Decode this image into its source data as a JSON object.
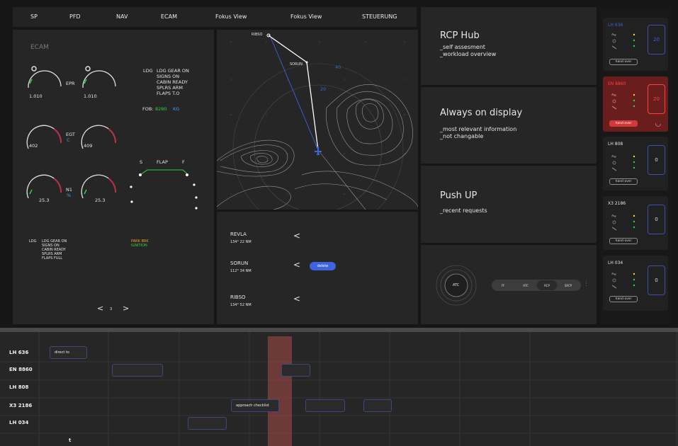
{
  "nav": {
    "items": [
      "SP",
      "PFD",
      "NAV",
      "ECAM",
      "Fokus View",
      "Fokus View",
      "STEUERUNG"
    ]
  },
  "ecam": {
    "title": "ECAM",
    "gauges": [
      {
        "value": "1.010",
        "label": "EPR"
      },
      {
        "value": "1.010",
        "label": ""
      },
      {
        "value": "402",
        "label": "EGT",
        "sub": "C"
      },
      {
        "value": "409",
        "label": ""
      },
      {
        "value": "25.3",
        "label": "N1",
        "sub": "%"
      },
      {
        "value": "25.3",
        "label": ""
      }
    ],
    "ldg_prefix": "LDG",
    "memo_upper": [
      "LDG GEAR ON",
      "SIGNS ON",
      "CABIN READY",
      "SPLRS ARM",
      "FLAPS T.O"
    ],
    "fob_label": "FOB:",
    "fob_value": "8280",
    "fob_unit": "KG",
    "flap_s": "S",
    "flap_label": "FLAP",
    "flap_f": "F",
    "memo_lower_prefix": "LDG",
    "memo_lower": [
      "LDG GEAR ON",
      "SIGNS ON",
      "CABIN READY",
      "SPLRS ARM",
      "FLAPS FULL"
    ],
    "memo_amber": "PARK BRK",
    "memo_green": "IGNITION",
    "page_prev": "<",
    "page_num": "3",
    "page_next": ">"
  },
  "nav_map": {
    "wpt_ribso": "RIBSO",
    "wpt_sorun": "SORUN",
    "range_40": "40",
    "range_20": "20"
  },
  "waypoints": [
    {
      "name": "REVLA",
      "detail": "134°   22 NM"
    },
    {
      "name": "SORUN",
      "detail": "112°   34 NM"
    },
    {
      "name": "RIBSO",
      "detail": "134°   52 NM"
    }
  ],
  "waypoint_chevron": "<",
  "delete_label": "delete",
  "info": {
    "rcp_title": "RCP Hub",
    "rcp_lines": [
      "_self assesment",
      "_workload overview"
    ],
    "aod_title": "Always on display",
    "aod_lines": [
      "_most relevant information",
      "_not changable"
    ],
    "push_title": "Push UP",
    "push_lines": [
      "_recent requests"
    ]
  },
  "control": {
    "radar_label": "ATC",
    "segments": [
      "FF",
      "ATC",
      "RCP",
      "SRCP"
    ],
    "more": "⋮"
  },
  "flights": [
    {
      "callsign": "LH 636",
      "level": "20",
      "handover": "hand over",
      "alert": false
    },
    {
      "callsign": "EN 8860",
      "level": "20",
      "handover": "hand over",
      "alert": true
    },
    {
      "callsign": "LH 808",
      "level": "0",
      "handover": "hand over",
      "alert": false
    },
    {
      "callsign": "X3 2186",
      "level": "0",
      "handover": "hand over",
      "alert": false
    },
    {
      "callsign": "LH 034",
      "level": "0",
      "handover": "hand over",
      "alert": false
    }
  ],
  "timeline": {
    "rows": [
      "LH 636",
      "EN 8860",
      "LH 808",
      "X3 2186",
      "LH 034"
    ],
    "direct_to": "direct to",
    "approach_checklist": "approach checklist",
    "time_marker": "t"
  },
  "colors": {
    "accent_blue": "#3d63e0",
    "alert_red": "#d23a3a",
    "ecam_green": "#2fd04a",
    "ecam_cyan": "#3aa5e8",
    "ecam_amber": "#f0a020"
  }
}
